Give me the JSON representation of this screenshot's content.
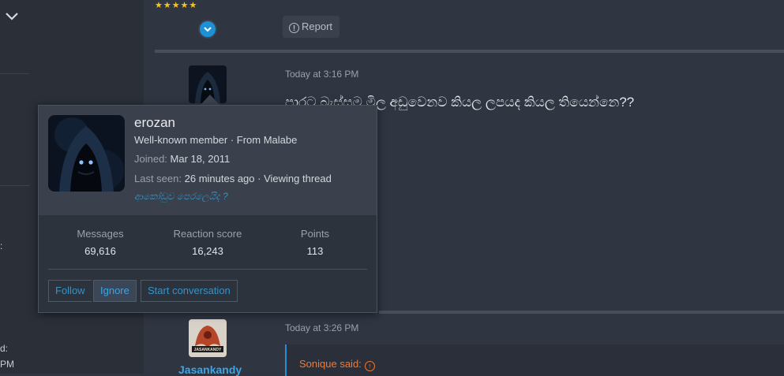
{
  "left_rail": {
    "fragments": [
      ":",
      "d:",
      "PM"
    ]
  },
  "post_prev": {
    "stars": "★★★★★",
    "report_label": "Report"
  },
  "post_main": {
    "timestamp": "Today at 3:16 PM",
    "text": "පාරට බැස්සම මිල අඩුවෙනව කියල ලපයද කියල තියෙන්නෙ??"
  },
  "post_next": {
    "timestamp": "Today at 3:26 PM",
    "username": "Jasankandy",
    "avatar_text": "JASANKANDY",
    "quote_author": "Sonique said:"
  },
  "member_popup": {
    "name": "erozan",
    "title": "Well-known member · From Malabe",
    "joined_label": "Joined:",
    "joined_value": "Mar 18, 2011",
    "last_seen_label": "Last seen:",
    "last_seen_value": "26 minutes ago · Viewing thread",
    "signature": "ආකෝඩුව පෙරලෙයිද ?",
    "stats": [
      {
        "label": "Messages",
        "value": "69,616"
      },
      {
        "label": "Reaction score",
        "value": "16,243"
      },
      {
        "label": "Points",
        "value": "113"
      }
    ],
    "buttons": {
      "follow": "Follow",
      "ignore": "Ignore",
      "start_conversation": "Start conversation"
    }
  },
  "colors": {
    "accent": "#1e90d6",
    "link": "#3592c8",
    "quote_author": "#f07a38",
    "star": "#f5c518"
  }
}
